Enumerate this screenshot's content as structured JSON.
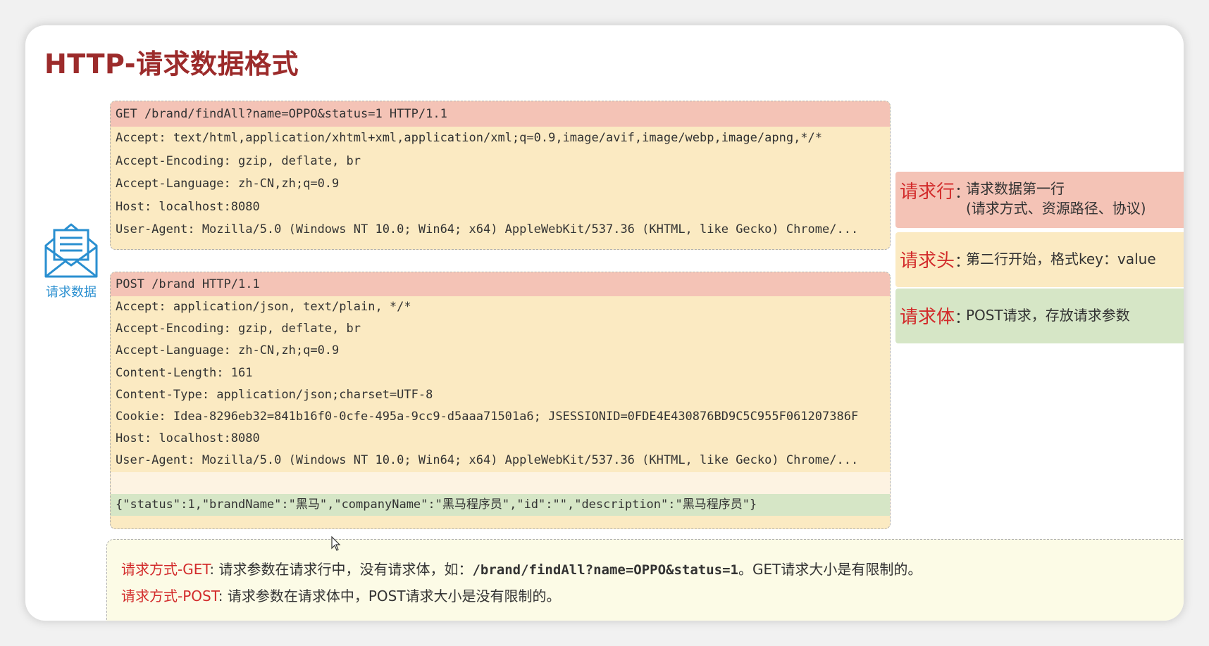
{
  "slide": {
    "title": "HTTP-请求数据格式"
  },
  "envelope": {
    "icon": "envelope-icon",
    "label": "请求数据",
    "color": "#2a8fd0"
  },
  "get_request": {
    "request_line": "GET /brand/findAll?name=OPPO&status=1 HTTP/1.1",
    "headers": [
      "Accept: text/html,application/xhtml+xml,application/xml;q=0.9,image/avif,image/webp,image/apng,*/*",
      "Accept-Encoding: gzip, deflate, br",
      "Accept-Language: zh-CN,zh;q=0.9",
      "Host: localhost:8080",
      "User-Agent: Mozilla/5.0 (Windows NT 10.0; Win64; x64) AppleWebKit/537.36 (KHTML, like Gecko) Chrome/..."
    ]
  },
  "post_request": {
    "request_line": "POST /brand HTTP/1.1",
    "headers": [
      "Accept: application/json, text/plain, */*",
      "Accept-Encoding: gzip, deflate, br",
      "Accept-Language: zh-CN,zh;q=0.9",
      "Content-Length: 161",
      "Content-Type: application/json;charset=UTF-8",
      "Cookie: Idea-8296eb32=841b16f0-0cfe-495a-9cc9-d5aaa71501a6; JSESSIONID=0FDE4E430876BD9C5C955F061207386F",
      "Host: localhost:8080",
      "User-Agent: Mozilla/5.0 (Windows NT 10.0; Win64; x64) AppleWebKit/537.36 (KHTML, like Gecko) Chrome/..."
    ],
    "body": "{\"status\":1,\"brandName\":\"黑马\",\"companyName\":\"黑马程序员\",\"id\":\"\",\"description\":\"黑马程序员\"}"
  },
  "legend": {
    "request_line": {
      "key": "请求行",
      "colon": "：",
      "desc_line1": "请求数据第一行",
      "desc_line2": "(请求方式、资源路径、协议)"
    },
    "request_header": {
      "key": "请求头",
      "colon": "：",
      "desc": "第二行开始，格式key：value"
    },
    "request_body": {
      "key": "请求体",
      "colon": "：",
      "desc": "POST请求，存放请求参数"
    }
  },
  "notes": {
    "get": {
      "key": "请求方式-GET",
      "text1": ": 请求参数在请求行中，没有请求体，如：",
      "code": "/brand/findAll?name=OPPO&status=1",
      "text2": "。GET请求大小是有限制的。"
    },
    "post": {
      "key": "请求方式-POST",
      "text": ": 请求参数在请求体中，POST请求大小是没有限制的。"
    }
  },
  "colors": {
    "title": "#9c2b2b",
    "request_line_bg": "#f4c3b6",
    "header_bg": "#fbeac2",
    "body_bg": "#d6e6c6",
    "accent_red": "#d22a2a"
  }
}
